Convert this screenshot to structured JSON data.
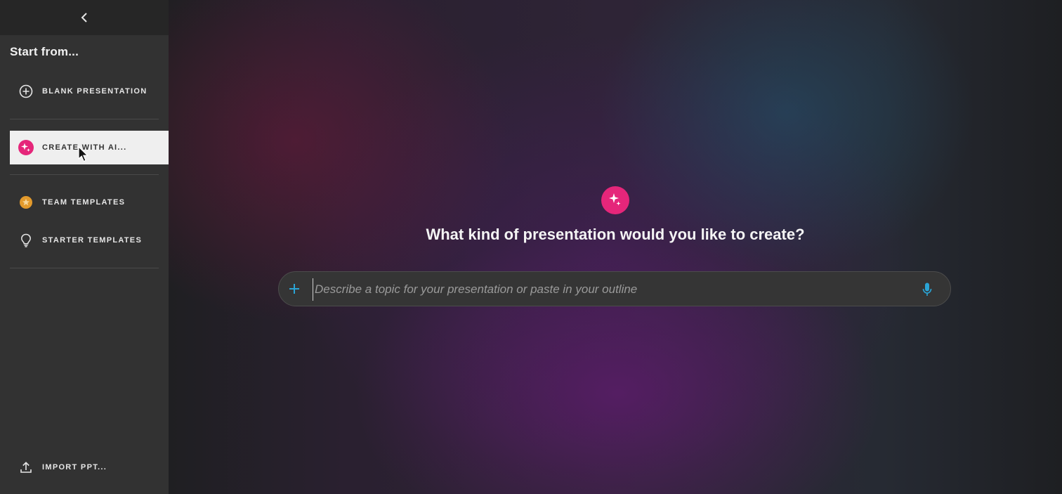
{
  "sidebar": {
    "heading": "Start from...",
    "items": [
      {
        "label": "BLANK PRESENTATION",
        "icon": "plus-circle-icon"
      },
      {
        "label": "CREATE WITH AI...",
        "icon": "ai-sparkle-icon",
        "active": true
      },
      {
        "label": "TEAM TEMPLATES",
        "icon": "star-badge-icon"
      },
      {
        "label": "STARTER TEMPLATES",
        "icon": "lightbulb-icon"
      }
    ],
    "import_label": "IMPORT PPT..."
  },
  "main": {
    "title": "What kind of presentation would you like to create?",
    "input_placeholder": "Describe a topic for your presentation or paste in your outline",
    "input_value": ""
  },
  "colors": {
    "accent_pink": "#e5267a",
    "accent_blue": "#2aa4d5",
    "star_orange": "#e39a2c"
  }
}
